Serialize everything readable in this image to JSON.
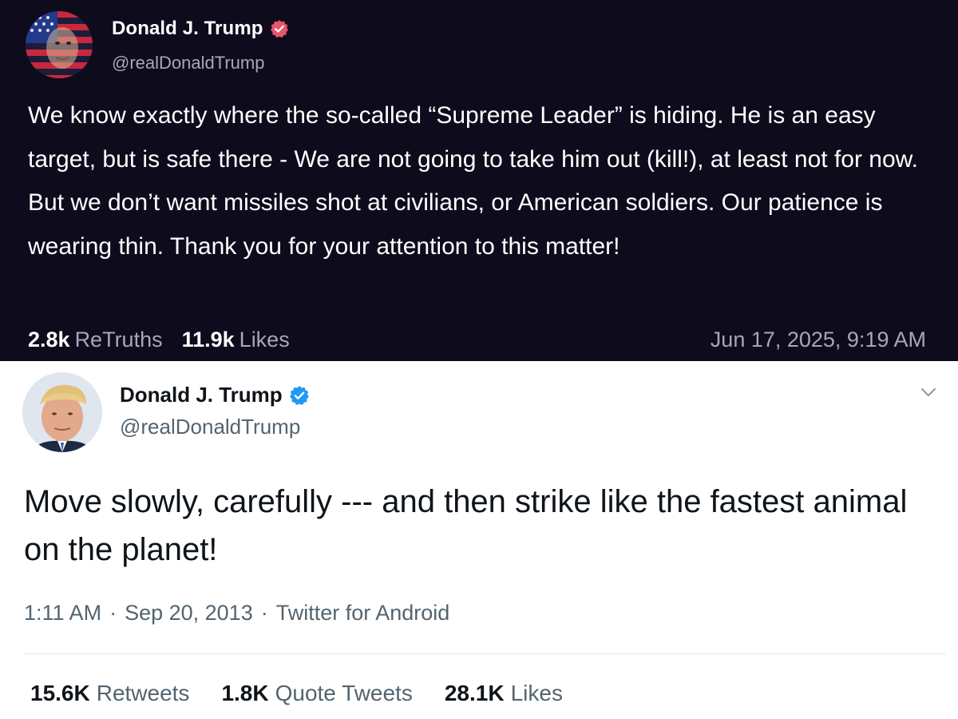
{
  "truth_post": {
    "display_name": "Donald J. Trump",
    "handle": "@realDonaldTrump",
    "verified_icon": "verified-badge-red",
    "text": "We know exactly where the so-called “Supreme Leader” is hiding. He is an easy target, but is safe there - We are not going to take him out (kill!), at least not for now. But we don’t want missiles shot at civilians, or American soldiers. Our patience is wearing thin. Thank you for your attention to this matter!",
    "retruths_count": "2.8k",
    "retruths_label": "ReTruths",
    "likes_count": "11.9k",
    "likes_label": "Likes",
    "timestamp": "Jun 17, 2025, 9:19 AM",
    "colors": {
      "background": "#0e0b1c",
      "badge": "#e8546a",
      "muted": "#a8a7b8"
    }
  },
  "tweet": {
    "display_name": "Donald J. Trump",
    "handle": "@realDonaldTrump",
    "verified_icon": "verified-badge-blue",
    "text": "Move slowly, carefully --- and then strike like the fastest animal on the planet!",
    "time": "1:11 AM",
    "separator": "·",
    "date": "Sep 20, 2013",
    "source": "Twitter for Android",
    "retweets_count": "15.6K",
    "retweets_label": "Retweets",
    "quote_tweets_count": "1.8K",
    "quote_tweets_label": "Quote Tweets",
    "likes_count": "28.1K",
    "likes_label": "Likes",
    "menu_icon": "chevron-down-icon",
    "colors": {
      "background": "#ffffff",
      "badge": "#1d9bf0",
      "muted": "#536471"
    }
  }
}
